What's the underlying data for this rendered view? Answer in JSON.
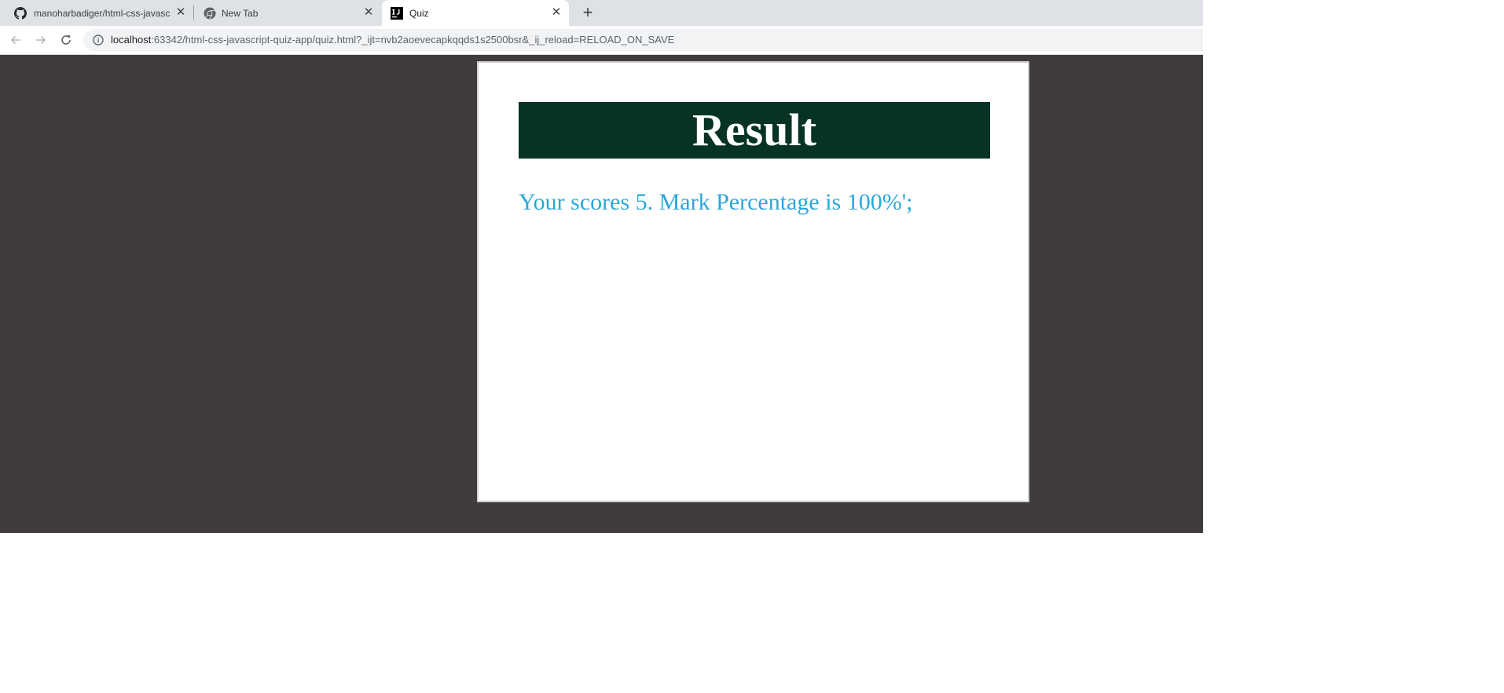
{
  "browser": {
    "tabs": [
      {
        "title": "manoharbadiger/html-css-javascript",
        "favicon": "github-icon",
        "active": false
      },
      {
        "title": "New Tab",
        "favicon": "chrome-icon",
        "active": false
      },
      {
        "title": "Quiz",
        "favicon": "intellij-icon",
        "active": true
      }
    ],
    "new_tab_label": "+",
    "close_label": "✕",
    "address": {
      "host": "localhost",
      "path": ":63342/html-css-javascript-quiz-app/quiz.html?_ijt=nvb2aoevecapkqqds1s2500bsr&_ij_reload=RELOAD_ON_SAVE"
    },
    "nav_icons": [
      "back-arrow-icon",
      "forward-arrow-icon",
      "reload-icon",
      "info-icon"
    ]
  },
  "page": {
    "result_title": "Result",
    "score_text": "Your scores 5. Mark Percentage is 100%';"
  },
  "colors": {
    "page_background": "#403c3b",
    "header_background": "#053324",
    "score_text": "#2ba7da",
    "card_background": "#ffffff"
  }
}
